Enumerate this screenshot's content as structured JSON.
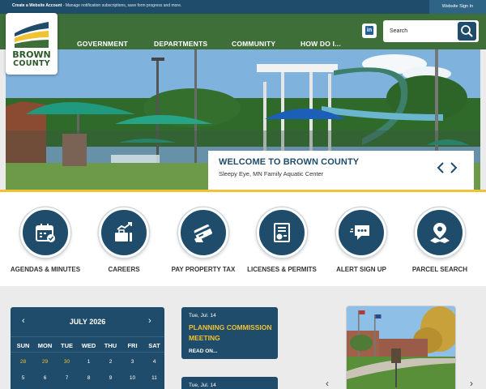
{
  "topbar": {
    "bold": "Create a Website Account",
    "message": " - Manage notification subscriptions, save form progress and more.",
    "signin": "Website Sign In"
  },
  "logo": {
    "line1": "BROWN",
    "line2": "COUNTY"
  },
  "nav": [
    "GOVERNMENT",
    "DEPARTMENTS",
    "COMMUNITY",
    "HOW DO I..."
  ],
  "social": {
    "linkedin": "in"
  },
  "search": {
    "placeholder": "Search"
  },
  "hero": {
    "title": "WELCOME TO BROWN COUNTY",
    "subtitle": "Sleepy Eye, MN Family Aquatic Center"
  },
  "quick_links": [
    {
      "label": "AGENDAS & MINUTES",
      "icon": "calendar-icon"
    },
    {
      "label": "CAREERS",
      "icon": "briefcase-chart-icon"
    },
    {
      "label": "PAY PROPERTY TAX",
      "icon": "credit-card-icon"
    },
    {
      "label": "LICENSES & PERMITS",
      "icon": "certificate-icon"
    },
    {
      "label": "ALERT SIGN UP",
      "icon": "chat-alert-icon"
    },
    {
      "label": "PARCEL SEARCH",
      "icon": "map-pin-icon"
    }
  ],
  "calendar": {
    "title": "JULY 2026",
    "prev": "‹",
    "next": "›",
    "dow": [
      "SUN",
      "MON",
      "TUE",
      "WED",
      "THU",
      "FRI",
      "SAT"
    ],
    "week1": [
      "28",
      "29",
      "30",
      "1",
      "2",
      "3",
      "4"
    ],
    "week2": [
      "5",
      "6",
      "7",
      "8",
      "9",
      "10",
      "11"
    ]
  },
  "events": [
    {
      "date": "Tue, Jul. 14",
      "title": "PLANNING COMMISSION MEETING",
      "more": "READ ON..."
    },
    {
      "date": "Tue, Jul. 14"
    }
  ],
  "colors": {
    "primary": "#1f4c6a",
    "green": "#3e6f39",
    "accent": "#f1c232"
  }
}
